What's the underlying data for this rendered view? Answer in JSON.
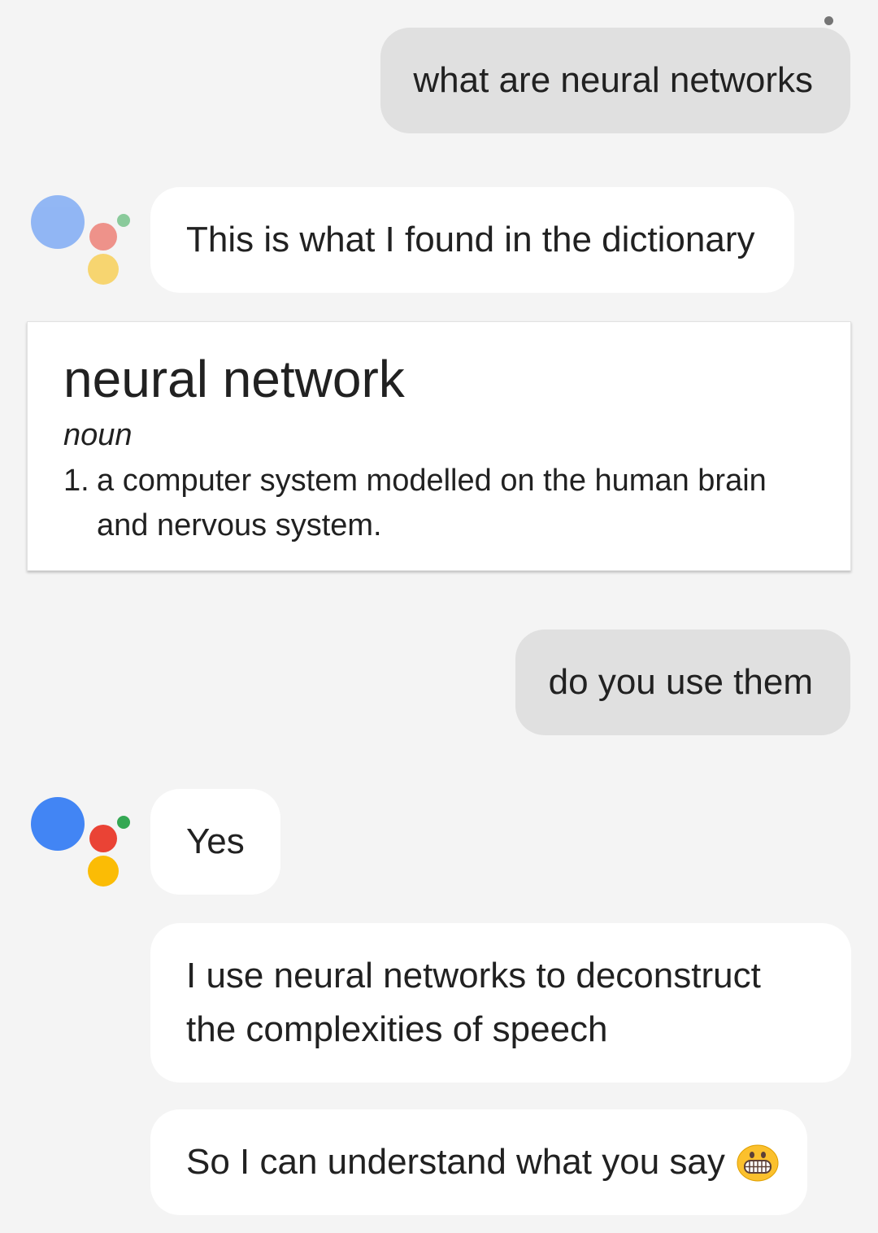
{
  "conversation": {
    "user_message_1": "what are neural networks",
    "assistant_message_1": "This is what I found in the dictionary",
    "user_message_2": "do you use them",
    "assistant_message_2": "Yes",
    "assistant_message_3": "I use neural networks to deconstruct the complexities of speech",
    "assistant_message_4": "So I can understand what you say",
    "assistant_message_4_emoji": "grinning-face-emoji"
  },
  "dictionary_card": {
    "term": "neural network",
    "part_of_speech": "noun",
    "definition_number": "1.",
    "definition": "a computer system modelled on the human brain and nervous system."
  },
  "icons": {
    "overflow_menu": "more-vert-icon",
    "assistant_logo": "google-assistant-logo"
  },
  "colors": {
    "background": "#f4f4f4",
    "user_bubble": "#e0e0e0",
    "assistant_bubble": "#ffffff",
    "logo_blue": "#4285f4",
    "logo_red": "#ea4335",
    "logo_yellow": "#fbbc05",
    "logo_green": "#34a853"
  }
}
